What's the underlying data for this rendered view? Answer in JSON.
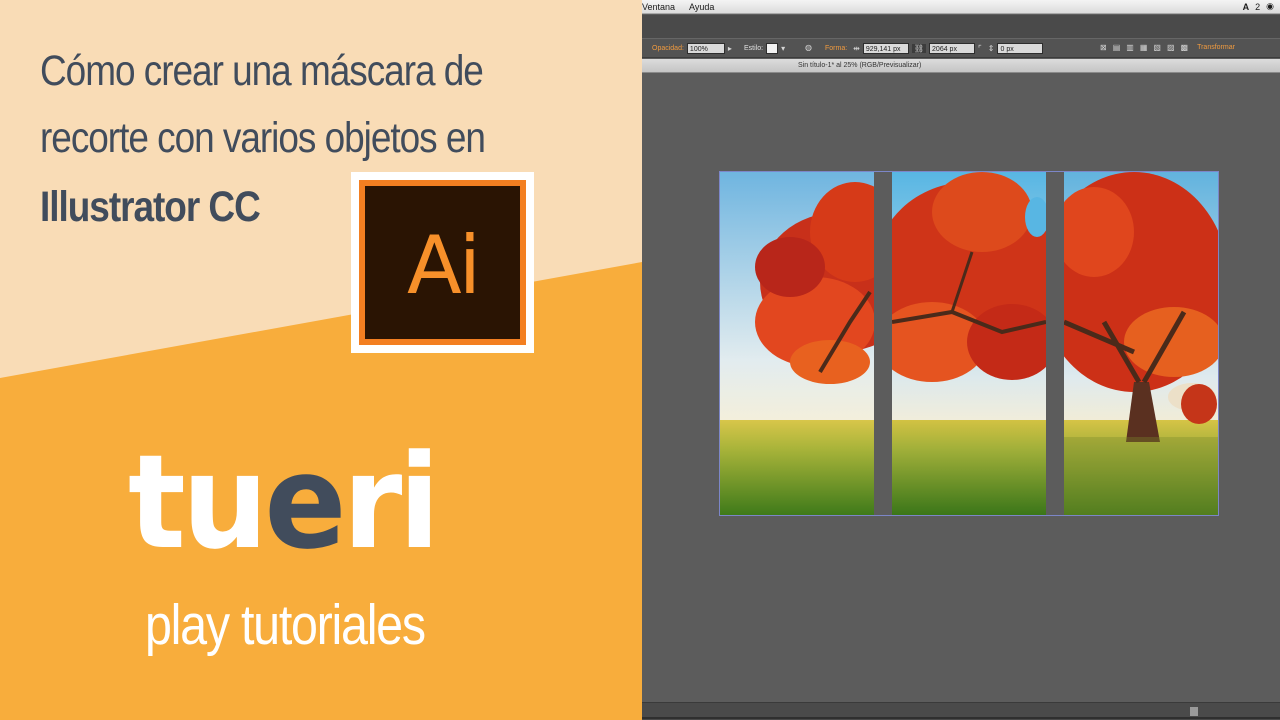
{
  "promo": {
    "title_line_1": "Cómo crear una máscara de",
    "title_line_2": "recorte con varios objetos en",
    "title_line_3": "Illustrator CC",
    "logo_text": "Ai",
    "brand_part_1": "tu",
    "brand_part_2": "e",
    "brand_part_3": "ri",
    "tagline": "play tutoriales",
    "colors": {
      "peach": "#f9dcb6",
      "orange": "#f8ad3c",
      "navy": "#414c5c",
      "ai_orange": "#f37f21",
      "ai_dark": "#2a1403"
    }
  },
  "app": {
    "menu": [
      "Ventana",
      "Ayuda"
    ],
    "menu_right": {
      "adobe_icon": "adobe-icon",
      "count": "2",
      "eye_icon": "eye-icon"
    },
    "control_bar": {
      "opacity_label": "Opacidad:",
      "opacity_value": "100%",
      "style_label": "Estilo:",
      "shape_label": "Forma:",
      "width_value": "929,141 px",
      "height_value": "2064 px",
      "corner_value": "0 px",
      "transform_label": "Transformar"
    },
    "document_title": "Sin título-1* al 25% (RGB/Previsualizar)"
  }
}
